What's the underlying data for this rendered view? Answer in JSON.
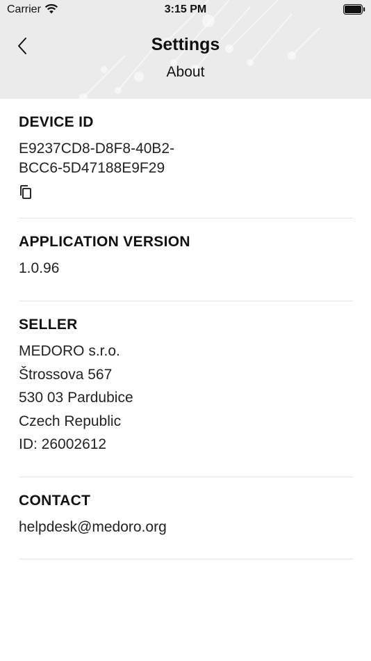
{
  "status_bar": {
    "carrier": "Carrier",
    "time": "3:15 PM",
    "icons": [
      "wifi-icon",
      "battery-icon"
    ]
  },
  "nav": {
    "back_icon": "chevron-left-icon",
    "title": "Settings",
    "subtitle": "About"
  },
  "colors": {
    "header_background": "#ebebeb",
    "background": "#ffffff",
    "separator": "#e6e6e6",
    "text": "#111111"
  },
  "sections": {
    "device_id": {
      "title": "DEVICE ID",
      "value_lines": [
        "E9237CD8-D8F8-40B2-",
        "BCC6-5D47188E9F29"
      ],
      "copy_icon": "copy-icon"
    },
    "app_version": {
      "title": "APPLICATION VERSION",
      "value": "1.0.96"
    },
    "seller": {
      "title": "SELLER",
      "lines": [
        "MEDORO s.r.o.",
        "Štrossova 567",
        "530 03 Pardubice",
        "Czech Republic",
        "ID: 26002612"
      ]
    },
    "contact": {
      "title": "CONTACT",
      "email": "helpdesk@medoro.org"
    }
  }
}
